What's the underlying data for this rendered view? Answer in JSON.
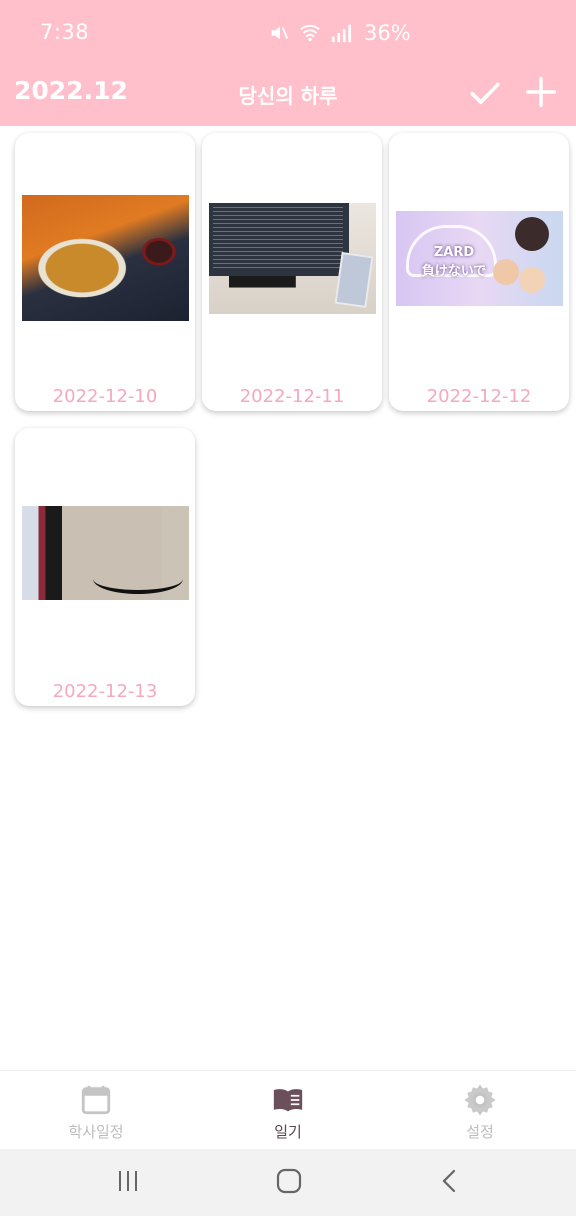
{
  "status_bar": {
    "time": "7:38",
    "battery": "36%",
    "icons": [
      "mute-icon",
      "wifi-icon",
      "signal-icon"
    ]
  },
  "header": {
    "month": "2022.12",
    "title": "당신의 하루",
    "actions": [
      "check-icon",
      "plus-icon"
    ]
  },
  "diary_entries": [
    {
      "date": "2022-12-10",
      "photo": "food-photo"
    },
    {
      "date": "2022-12-11",
      "photo": "monitor-photo"
    },
    {
      "date": "2022-12-12",
      "photo": "zard-thumbnail",
      "photo_text": "ZARD\n負けないで"
    },
    {
      "date": "2022-12-13",
      "photo": "desk-photo"
    }
  ],
  "bottom_nav": {
    "items": [
      {
        "label": "학사일정",
        "icon": "calendar-icon",
        "active": false
      },
      {
        "label": "일기",
        "icon": "book-icon",
        "active": true
      },
      {
        "label": "설정",
        "icon": "gear-icon",
        "active": false
      }
    ]
  },
  "colors": {
    "header_bg": "#ffc0cb",
    "date_text": "#f4a9bd",
    "nav_active": "#5a4550",
    "nav_inactive": "#bdbdbd"
  },
  "system_nav": [
    "recents-icon",
    "home-icon",
    "back-icon"
  ]
}
